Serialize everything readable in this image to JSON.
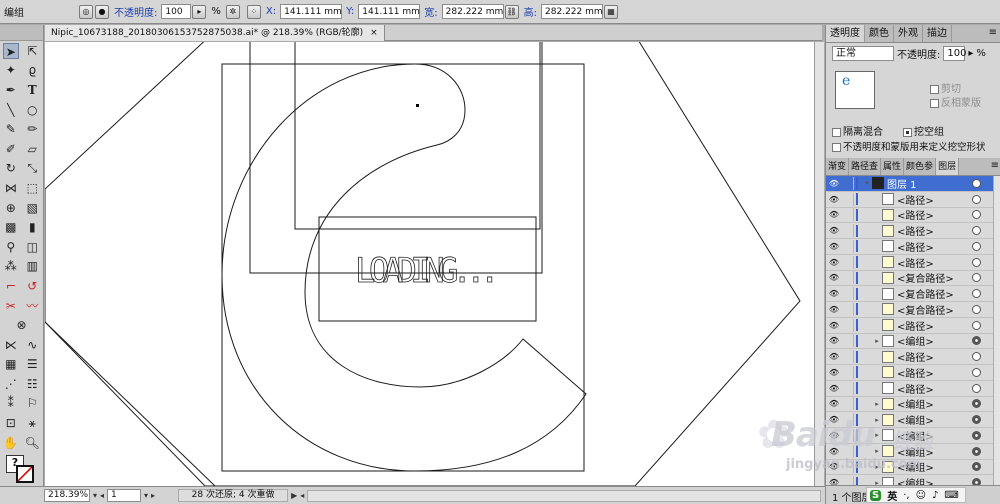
{
  "control_bar": {
    "group_label": "编组",
    "opacity_label": "不透明度:",
    "opacity_value": "100",
    "opacity_unit": "%",
    "x_label": "X:",
    "x_value": "141.111 mm",
    "y_label": "Y:",
    "y_value": "141.111 mm",
    "w_label": "宽:",
    "w_value": "282.222 mm",
    "h_label": "高:",
    "h_value": "282.222 mm"
  },
  "document": {
    "tab_title": "Nipic_10673188_20180306153752875038.ai* @ 218.39% (RGB/轮廓)",
    "close_glyph": "×",
    "artwork_text": "LOADING..."
  },
  "status_bar": {
    "zoom": "218.39%",
    "page": "1",
    "history": "28 次还原; 4 次重做"
  },
  "transparency_panel": {
    "tabs": [
      "透明度",
      "颜色",
      "外观",
      "描边"
    ],
    "blend_mode": "正常",
    "opacity_label": "不透明度:",
    "opacity_value": "100",
    "opacity_unit": "%",
    "thumb_glyph": "e",
    "clip_label": "剪切",
    "invert_mask_label": "反相蒙版",
    "isolate_blending_label": "隔离混合",
    "knockout_group_label": "挖空组",
    "opacity_mask_label": "不透明度和蒙版用来定义挖空形状"
  },
  "layers_panel": {
    "tabs": [
      "渐变",
      "路径查",
      "属性",
      "颜色参",
      "图层"
    ],
    "rows": [
      {
        "name": "图层 1",
        "type": "layer"
      },
      {
        "name": "<路径>",
        "type": "path"
      },
      {
        "name": "<路径>",
        "type": "path"
      },
      {
        "name": "<路径>",
        "type": "path"
      },
      {
        "name": "<路径>",
        "type": "path"
      },
      {
        "name": "<路径>",
        "type": "path"
      },
      {
        "name": "<复合路径>",
        "type": "path"
      },
      {
        "name": "<复合路径>",
        "type": "path"
      },
      {
        "name": "<复合路径>",
        "type": "path"
      },
      {
        "name": "<路径>",
        "type": "path"
      },
      {
        "name": "<编组>",
        "type": "group"
      },
      {
        "name": "<路径>",
        "type": "path"
      },
      {
        "name": "<路径>",
        "type": "path"
      },
      {
        "name": "<路径>",
        "type": "path"
      },
      {
        "name": "<编组>",
        "type": "group"
      },
      {
        "name": "<编组>",
        "type": "group"
      },
      {
        "name": "<编组>",
        "type": "group"
      },
      {
        "name": "<编组>",
        "type": "group"
      },
      {
        "name": "<编组>",
        "type": "group"
      },
      {
        "name": "<编组>",
        "type": "group"
      }
    ],
    "status": "1 个图层"
  },
  "watermark": {
    "logo": "Baidu",
    "sub": "经验",
    "url": "jingyan.baidu.com",
    "ime": "英"
  }
}
